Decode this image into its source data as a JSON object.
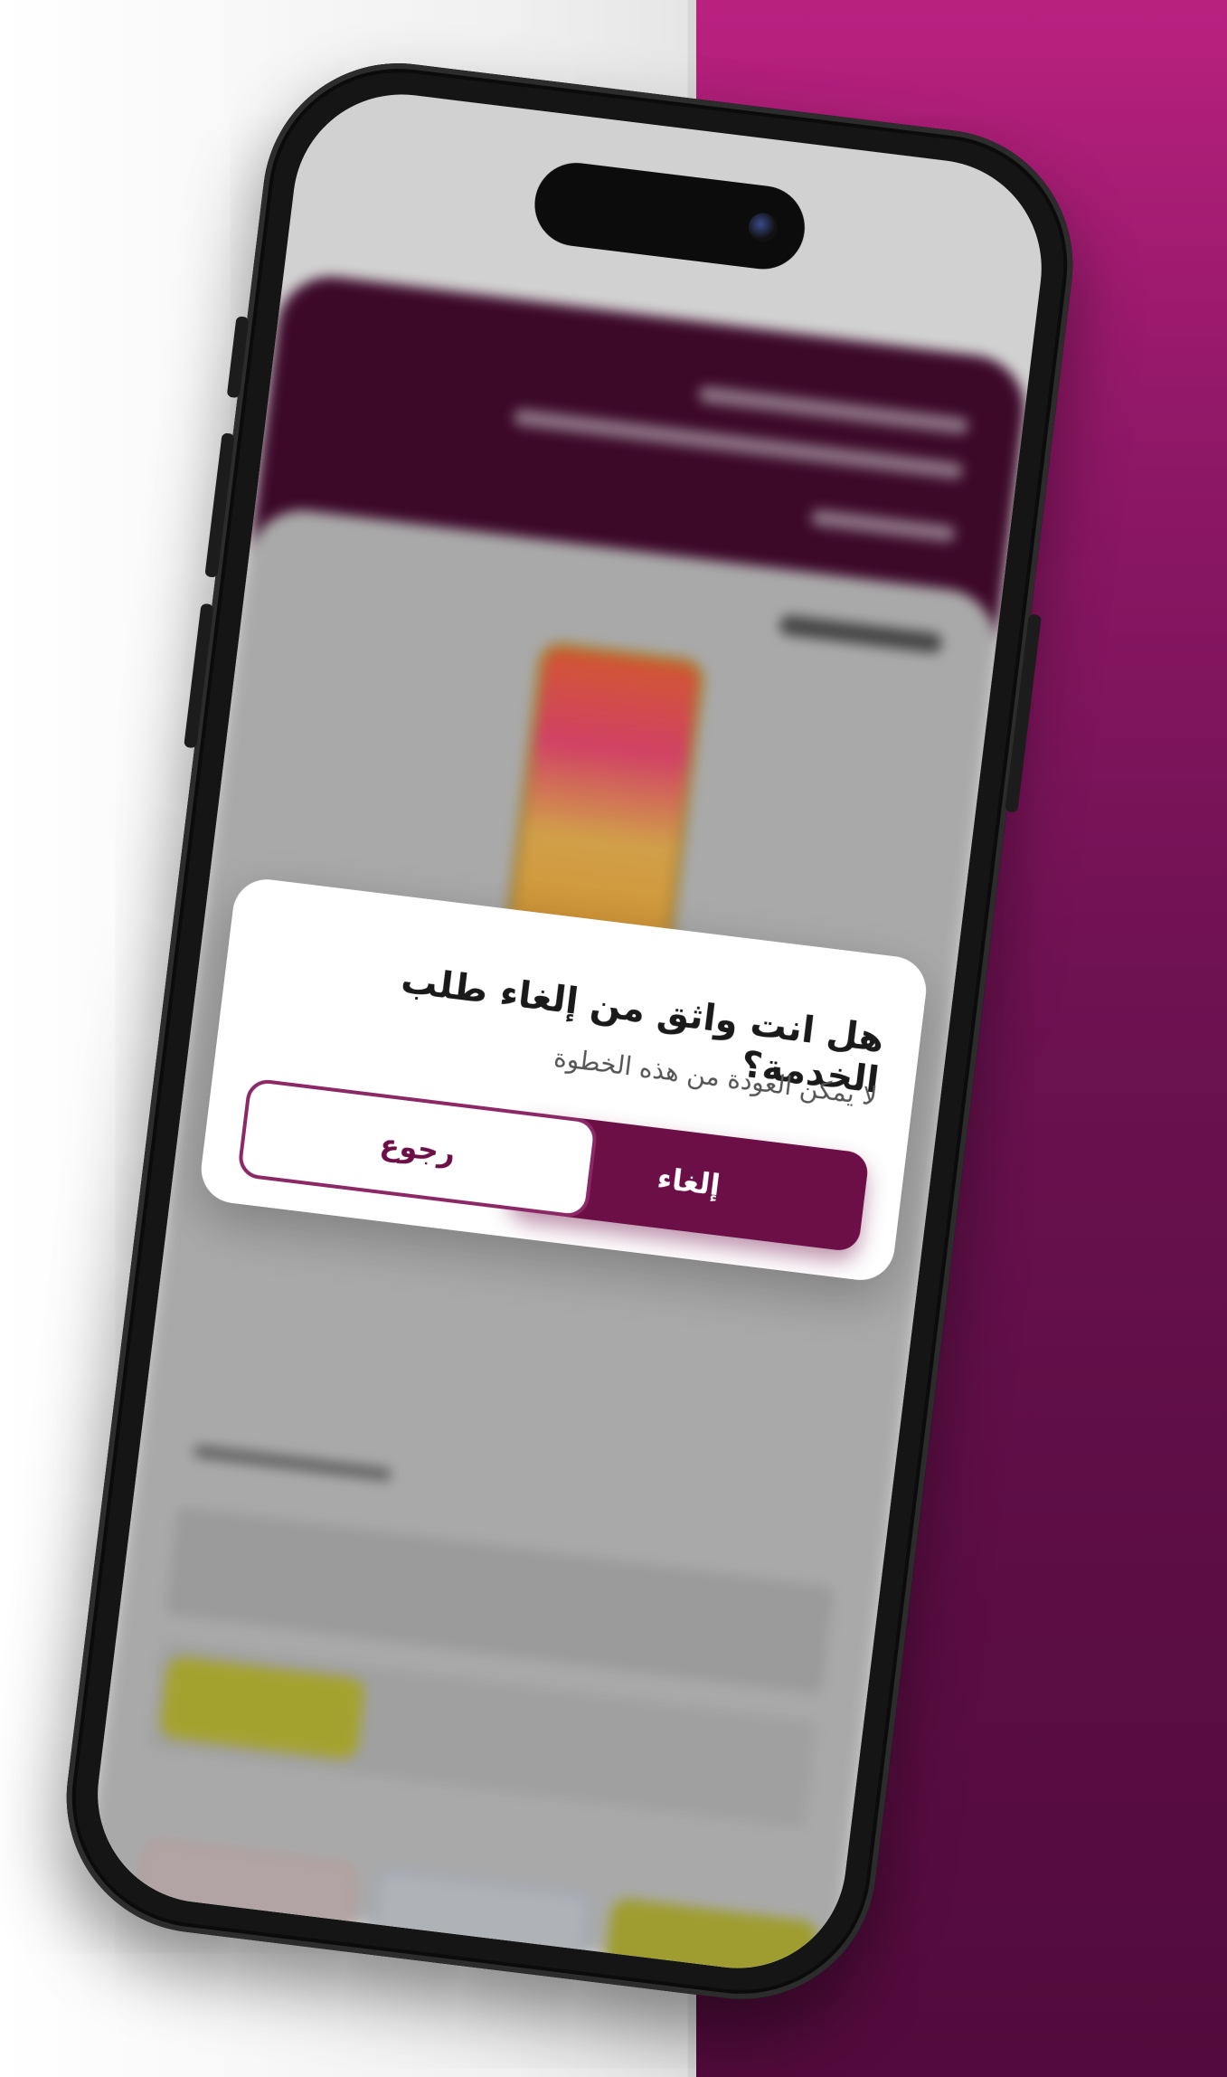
{
  "colors": {
    "brand": "#6c0f47",
    "brand_outline": "#8d2867",
    "backdrop": "#8e1766"
  },
  "dialog": {
    "title": "هل انت واثق من إلغاء طلب الخدمة؟",
    "subtitle": "لا يمكن العودة من هذه الخطوة",
    "confirm_label": "إلغاء",
    "back_label": "رجوع"
  }
}
